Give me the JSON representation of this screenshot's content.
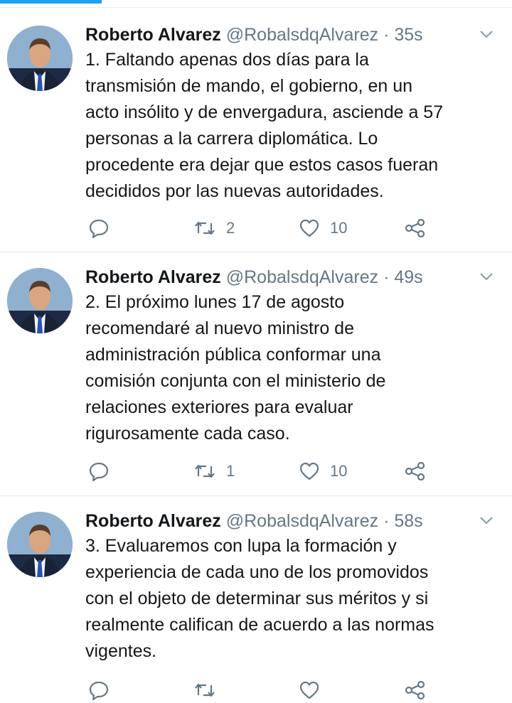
{
  "tweets": [
    {
      "name": "Roberto Alvarez",
      "handle": "@RobalsdqAlvarez",
      "separator": "·",
      "time": "35s",
      "text": "1. Faltando apenas dos días para la\ntransmisión de mando, el gobierno, en un\nacto insólito y de envergadura, asciende a 57\npersonas a la carrera diplomática. Lo\nprocedente era dejar que estos casos fueran\ndecididos por las nuevas autoridades.",
      "retweets": "2",
      "likes": "10"
    },
    {
      "name": "Roberto Alvarez",
      "handle": "@RobalsdqAlvarez",
      "separator": "·",
      "time": "49s",
      "text": "2. El próximo lunes 17 de agosto\nrecomendaré al nuevo ministro de\nadministración pública conformar una\ncomisión conjunta con el ministerio de\nrelaciones exteriores para evaluar\nrigurosamente cada caso.",
      "retweets": "1",
      "likes": "10"
    },
    {
      "name": "Roberto Alvarez",
      "handle": "@RobalsdqAlvarez",
      "separator": "·",
      "time": "58s",
      "text": "3. Evaluaremos con lupa la formación y\nexperiencia de cada uno de los promovidos\ncon el objeto de determinar sus méritos y si\nrealmente califican de acuerdo a las normas\nvigentes.",
      "retweets": "",
      "likes": ""
    }
  ],
  "colors": {
    "accent": "#1da1f2",
    "text": "#14171a",
    "muted": "#657786",
    "divider": "#e1e8ed"
  },
  "icons": [
    "reply-icon",
    "retweet-icon",
    "like-icon",
    "share-icon",
    "chevron-down-icon"
  ]
}
